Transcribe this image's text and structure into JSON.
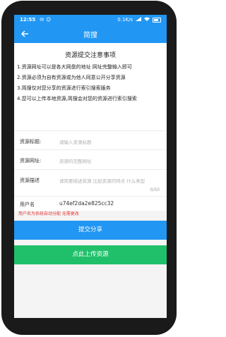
{
  "status_bar": {
    "time": "12:55",
    "indicators": [
      "✉",
      "☺"
    ],
    "network_speed": "0.1K/s",
    "battery_icon": "battery-icon"
  },
  "app_bar": {
    "title": "简搜",
    "back_icon": "arrow-back-icon"
  },
  "notice": {
    "title": "资源提交注意事项",
    "lines": [
      "1.资源网址可以是各大网盘的地址 网址完整输入即可",
      "2.资源必须为自有资源或为他人同意公开分享资源",
      "3.简搜仅对您分享的资源进行索引搜索服务",
      "4.您可以上传本地资源,简搜会对您的资源进行索引搜索"
    ]
  },
  "form": {
    "title_label": "资源标题:",
    "title_placeholder": "请输入资源标题",
    "url_label": "资源网址:",
    "url_placeholder": "资源的完整网址",
    "desc_label": "资源描述",
    "desc_placeholder": "请简要描述资源 比如资源的特点 什么类型",
    "desc_counter": "0/50",
    "username_label": "用户名",
    "username_value": "u74ef2da2e825cc32",
    "username_hint": "用户名为系统自动分配 无需更改"
  },
  "buttons": {
    "submit": "提交分享",
    "upload": "点此上传资源"
  },
  "colors": {
    "primary": "#2196f3",
    "success": "#20c06a",
    "hint": "#e53935"
  }
}
